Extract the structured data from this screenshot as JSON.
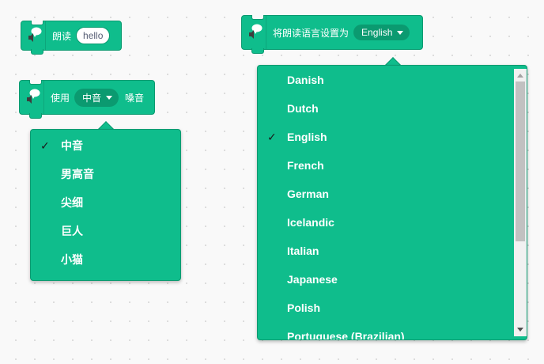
{
  "blocks": {
    "speak": {
      "label": "朗读",
      "value": "hello"
    },
    "voice": {
      "label_before": "使用",
      "selected": "中音",
      "label_after": "嗓音"
    },
    "language": {
      "label": "将朗读语言设置为",
      "selected": "English"
    }
  },
  "voice_menu": {
    "checked_index": 0,
    "items": [
      "中音",
      "男高音",
      "尖细",
      "巨人",
      "小猫"
    ]
  },
  "language_menu": {
    "checked_index": 2,
    "items": [
      "Danish",
      "Dutch",
      "English",
      "French",
      "German",
      "Icelandic",
      "Italian",
      "Japanese",
      "Polish",
      "Portuguese (Brazilian)"
    ]
  },
  "check_mark": "✓",
  "icons": {
    "block_icon": "speech-bubble-speaker-icon"
  },
  "colors": {
    "block": "#0fbd8c",
    "block_border": "#0b9a70",
    "dropdown_field": "#0b9a70",
    "canvas": "#f9f9f9"
  }
}
